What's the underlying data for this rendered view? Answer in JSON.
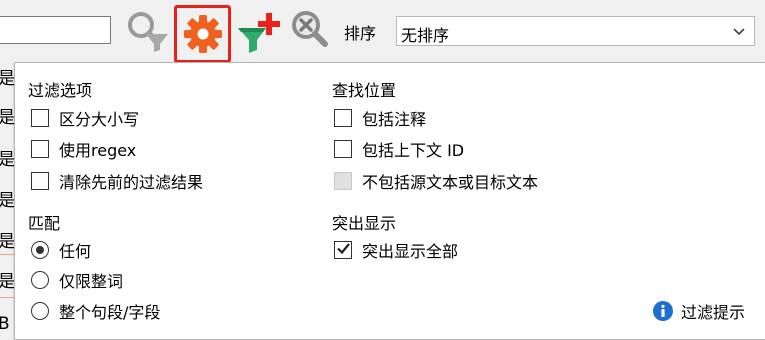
{
  "toolbar": {
    "filter_value": "",
    "sort_label": "排序",
    "sort_value": "无排序"
  },
  "background": {
    "row_char": "是",
    "bottom_char": "B"
  },
  "panel": {
    "filter_options": {
      "title": "过滤选项",
      "case_sensitive": {
        "label": "区分大小写",
        "checked": false
      },
      "use_regex": {
        "label": "使用regex",
        "checked": false
      },
      "clear_previous": {
        "label": "清除先前的过滤结果",
        "checked": false
      }
    },
    "match": {
      "title": "匹配",
      "any": {
        "label": "任何",
        "selected": true
      },
      "whole_word": {
        "label": "仅限整词",
        "selected": false
      },
      "whole_segment": {
        "label": "整个句段/字段",
        "selected": false
      }
    },
    "search_location": {
      "title": "查找位置",
      "include_comments": {
        "label": "包括注释",
        "checked": false
      },
      "include_context_id": {
        "label": "包括上下文 ID",
        "checked": false
      },
      "exclude_source_target": {
        "label": "不包括源文本或目标文本",
        "checked": false,
        "disabled": true
      }
    },
    "highlight": {
      "title": "突出显示",
      "highlight_all": {
        "label": "突出显示全部",
        "checked": true
      }
    },
    "hint": {
      "label": "过滤提示"
    }
  },
  "colors": {
    "accent_red": "#e8221a",
    "gear_orange": "#f0601e",
    "info_blue": "#1c6fd1",
    "green_funnel": "#2faa6a"
  }
}
